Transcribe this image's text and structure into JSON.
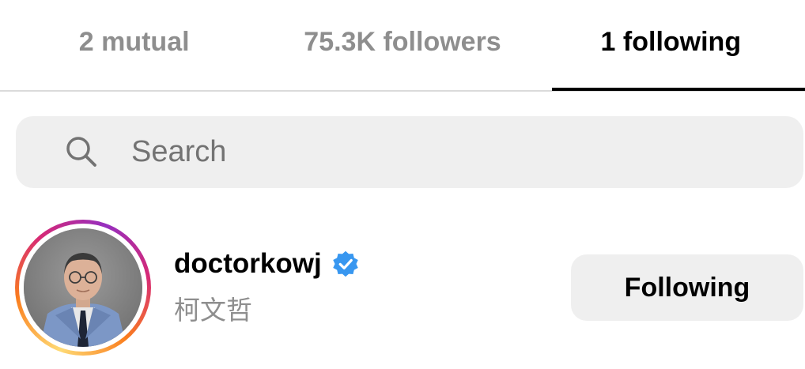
{
  "tabs": [
    {
      "label": "2 mutual",
      "active": false
    },
    {
      "label": "75.3K followers",
      "active": false
    },
    {
      "label": "1 following",
      "active": true
    }
  ],
  "search": {
    "placeholder": "Search",
    "value": "",
    "icon": "search-icon"
  },
  "users": [
    {
      "username": "doctorkowj",
      "full_name": "柯文哲",
      "verified": true,
      "has_story_ring": true,
      "button_label": "Following"
    }
  ],
  "colors": {
    "verified_blue": "#3897f0",
    "muted_text": "#8e8e8e",
    "button_bg": "#efefef"
  }
}
